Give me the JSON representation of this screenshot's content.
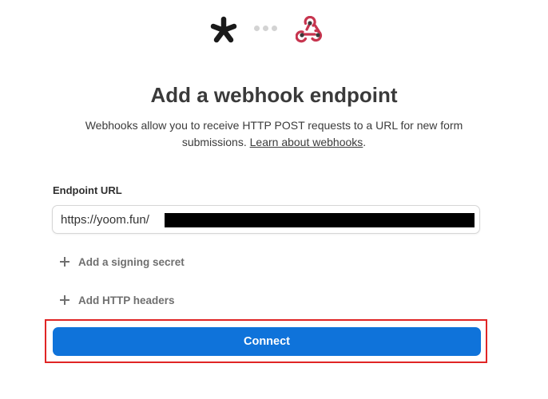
{
  "header": {
    "left_logo_icon": "asterisk-icon",
    "separator_icon": "ellipsis-dots-icon",
    "right_logo_icon": "webhook-icon"
  },
  "title": "Add a webhook endpoint",
  "description": {
    "text": "Webhooks allow you to receive HTTP POST requests to a URL for new form submissions. ",
    "link_text": "Learn about webhooks",
    "suffix": "."
  },
  "endpoint": {
    "label": "Endpoint URL",
    "value": "https://yoom.fun/"
  },
  "options": {
    "signing_secret_label": "Add a signing secret",
    "http_headers_label": "Add HTTP headers"
  },
  "actions": {
    "connect_label": "Connect"
  },
  "colors": {
    "primary_button": "#0f73da",
    "highlight_frame": "#e02525",
    "webhook_logo": "#c7354f"
  }
}
